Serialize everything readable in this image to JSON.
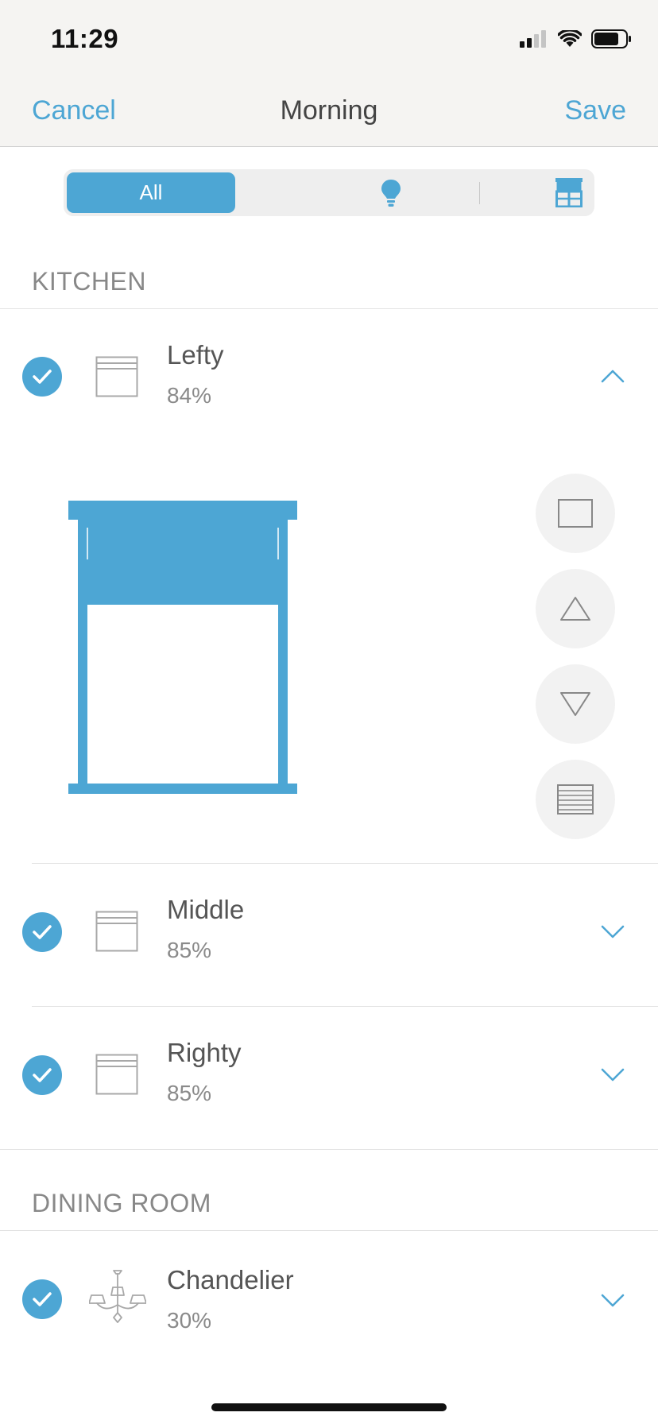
{
  "status_bar": {
    "time": "11:29",
    "icons": [
      "cellular-signal-icon",
      "wifi-icon",
      "battery-icon"
    ]
  },
  "nav": {
    "cancel_label": "Cancel",
    "title": "Morning",
    "save_label": "Save"
  },
  "filter": {
    "segments": [
      {
        "label": "All",
        "selected": true
      },
      {
        "icon": "lightbulb-icon",
        "selected": false
      },
      {
        "icon": "window-shade-icon",
        "selected": false
      }
    ]
  },
  "sections": [
    {
      "title": "KITCHEN",
      "items": [
        {
          "name": "Lefty",
          "value": "84%",
          "icon": "window-shade-icon",
          "checked": true,
          "expanded": true
        },
        {
          "name": "Middle",
          "value": "85%",
          "icon": "window-shade-icon",
          "checked": true,
          "expanded": false
        },
        {
          "name": "Righty",
          "value": "85%",
          "icon": "window-shade-icon",
          "checked": true,
          "expanded": false
        }
      ]
    },
    {
      "title": "DINING ROOM",
      "items": [
        {
          "name": "Chandelier",
          "value": "30%",
          "icon": "chandelier-icon",
          "checked": true,
          "expanded": false
        }
      ]
    }
  ],
  "shade_controls": [
    "open-shade-icon",
    "raise-arrow-icon",
    "lower-arrow-icon",
    "close-shade-icon"
  ],
  "colors": {
    "accent": "#4da6d4",
    "nav_background": "#f5f4f2",
    "secondary_text": "#8a8a8a"
  }
}
